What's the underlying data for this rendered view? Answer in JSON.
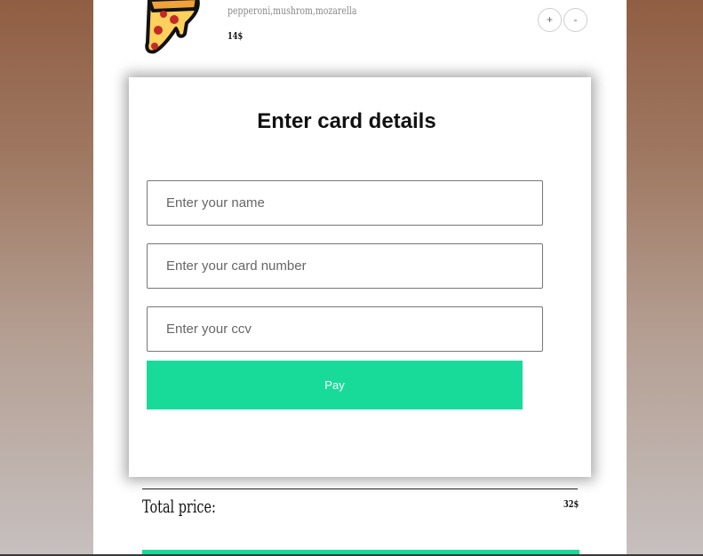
{
  "order_item": {
    "icon": "pizza-slice-icon",
    "ingredients": "pepperoni,mushrom,mozarella",
    "price": "14$",
    "increase_label": "+",
    "decrease_label": "-"
  },
  "card_form": {
    "title": "Enter card details",
    "name_placeholder": "Enter your name",
    "card_number_placeholder": "Enter your card number",
    "ccv_placeholder": "Enter your ccv",
    "pay_label": "Pay"
  },
  "summary": {
    "total_label": "Total price:",
    "total_value": "32$"
  },
  "colors": {
    "accent": "#18db9a",
    "pizza_crust": "#f0a23a",
    "pizza_cheese": "#ffd15c",
    "pepperoni": "#c62828"
  }
}
